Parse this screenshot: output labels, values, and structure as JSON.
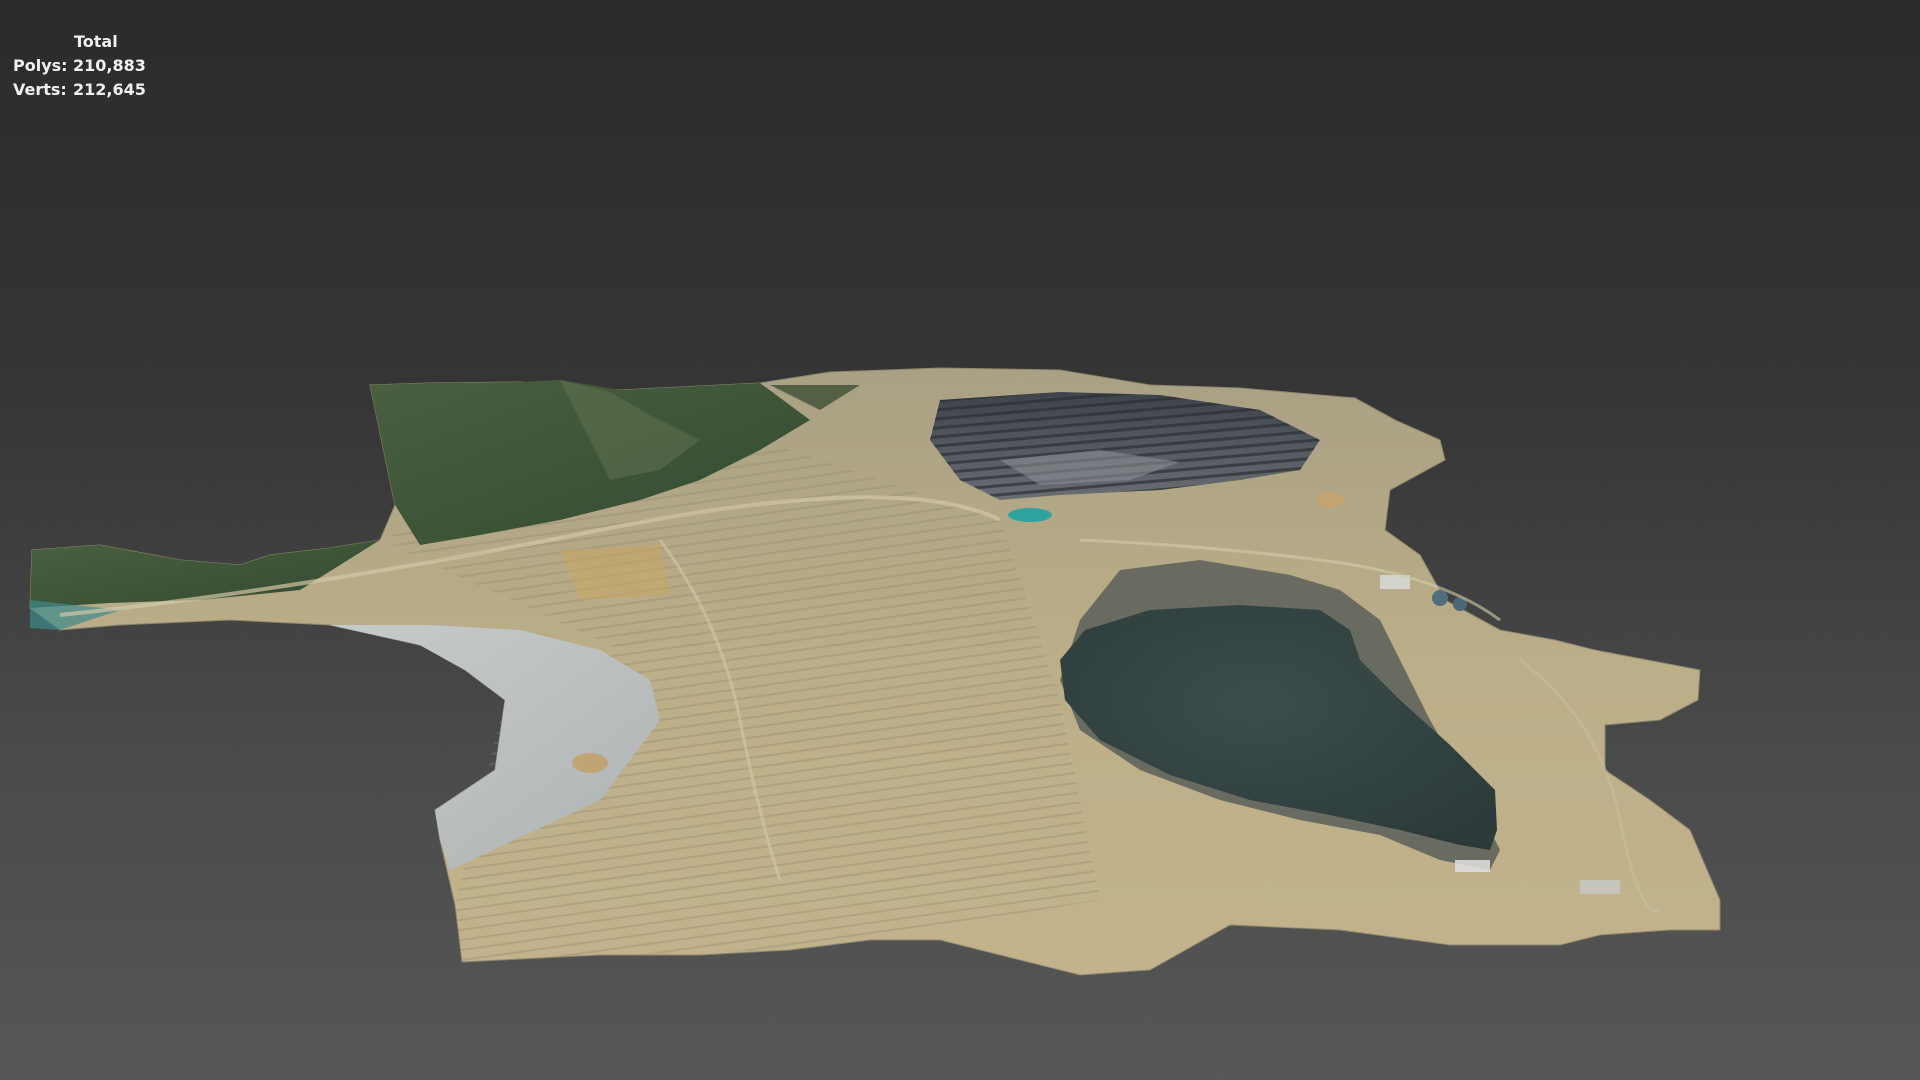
{
  "viewport_stats": {
    "title": "Total",
    "polys_label": "Polys:",
    "polys_value": "210,883",
    "verts_label": "Verts:",
    "verts_value": "212,645"
  },
  "colors": {
    "background_top": "#2b2b2b",
    "background_bottom": "#575757",
    "stats_text": "#f0f0f0",
    "terrain_base": "#b8aa86",
    "vegetation": "#3f5236",
    "tailings": "#b9bec0",
    "pit_lake": "#334544",
    "pit_terraces": "#4a4f57",
    "small_pond": "#2fa3a0"
  }
}
